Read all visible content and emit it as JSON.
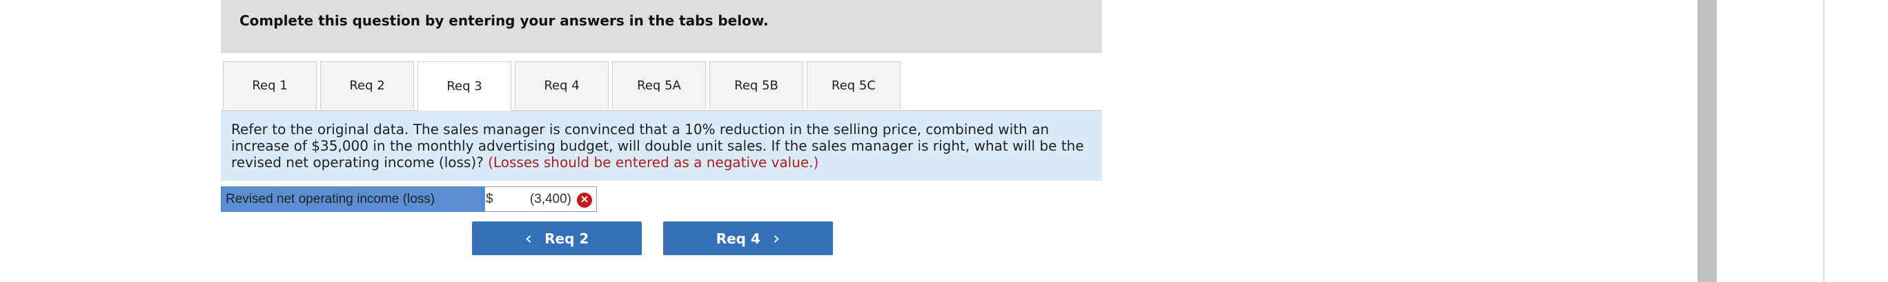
{
  "header": {
    "title": "Complete this question by entering your answers in the tabs below."
  },
  "tabs": [
    {
      "label": "Req 1"
    },
    {
      "label": "Req 2"
    },
    {
      "label": "Req 3"
    },
    {
      "label": "Req 4"
    },
    {
      "label": "Req 5A"
    },
    {
      "label": "Req 5B"
    },
    {
      "label": "Req 5C"
    }
  ],
  "active_tab": "Req 3",
  "question": {
    "text": "Refer to the original data. The sales manager is convinced that a 10% reduction in the selling price, combined with an increase of $35,000 in the monthly advertising budget, will double unit sales. If the sales manager is right, what will be the revised net operating income (loss)? ",
    "note": "(Losses should be entered as a negative value.)"
  },
  "answer": {
    "label": "Revised net operating income (loss)",
    "currency": "$",
    "value": "(3,400)",
    "status_icon": "error-x-icon"
  },
  "navigation": {
    "prev_label": "Req 2",
    "next_label": "Req 4",
    "prev_icon": "chevron-left-icon",
    "next_icon": "chevron-right-icon"
  },
  "colors": {
    "header_bg": "#dedede",
    "question_bg": "#dbeaf7",
    "label_bg": "#5b8fd4",
    "button_bg": "#3270b8",
    "error": "#c8161d",
    "note_text": "#b01d1d"
  }
}
